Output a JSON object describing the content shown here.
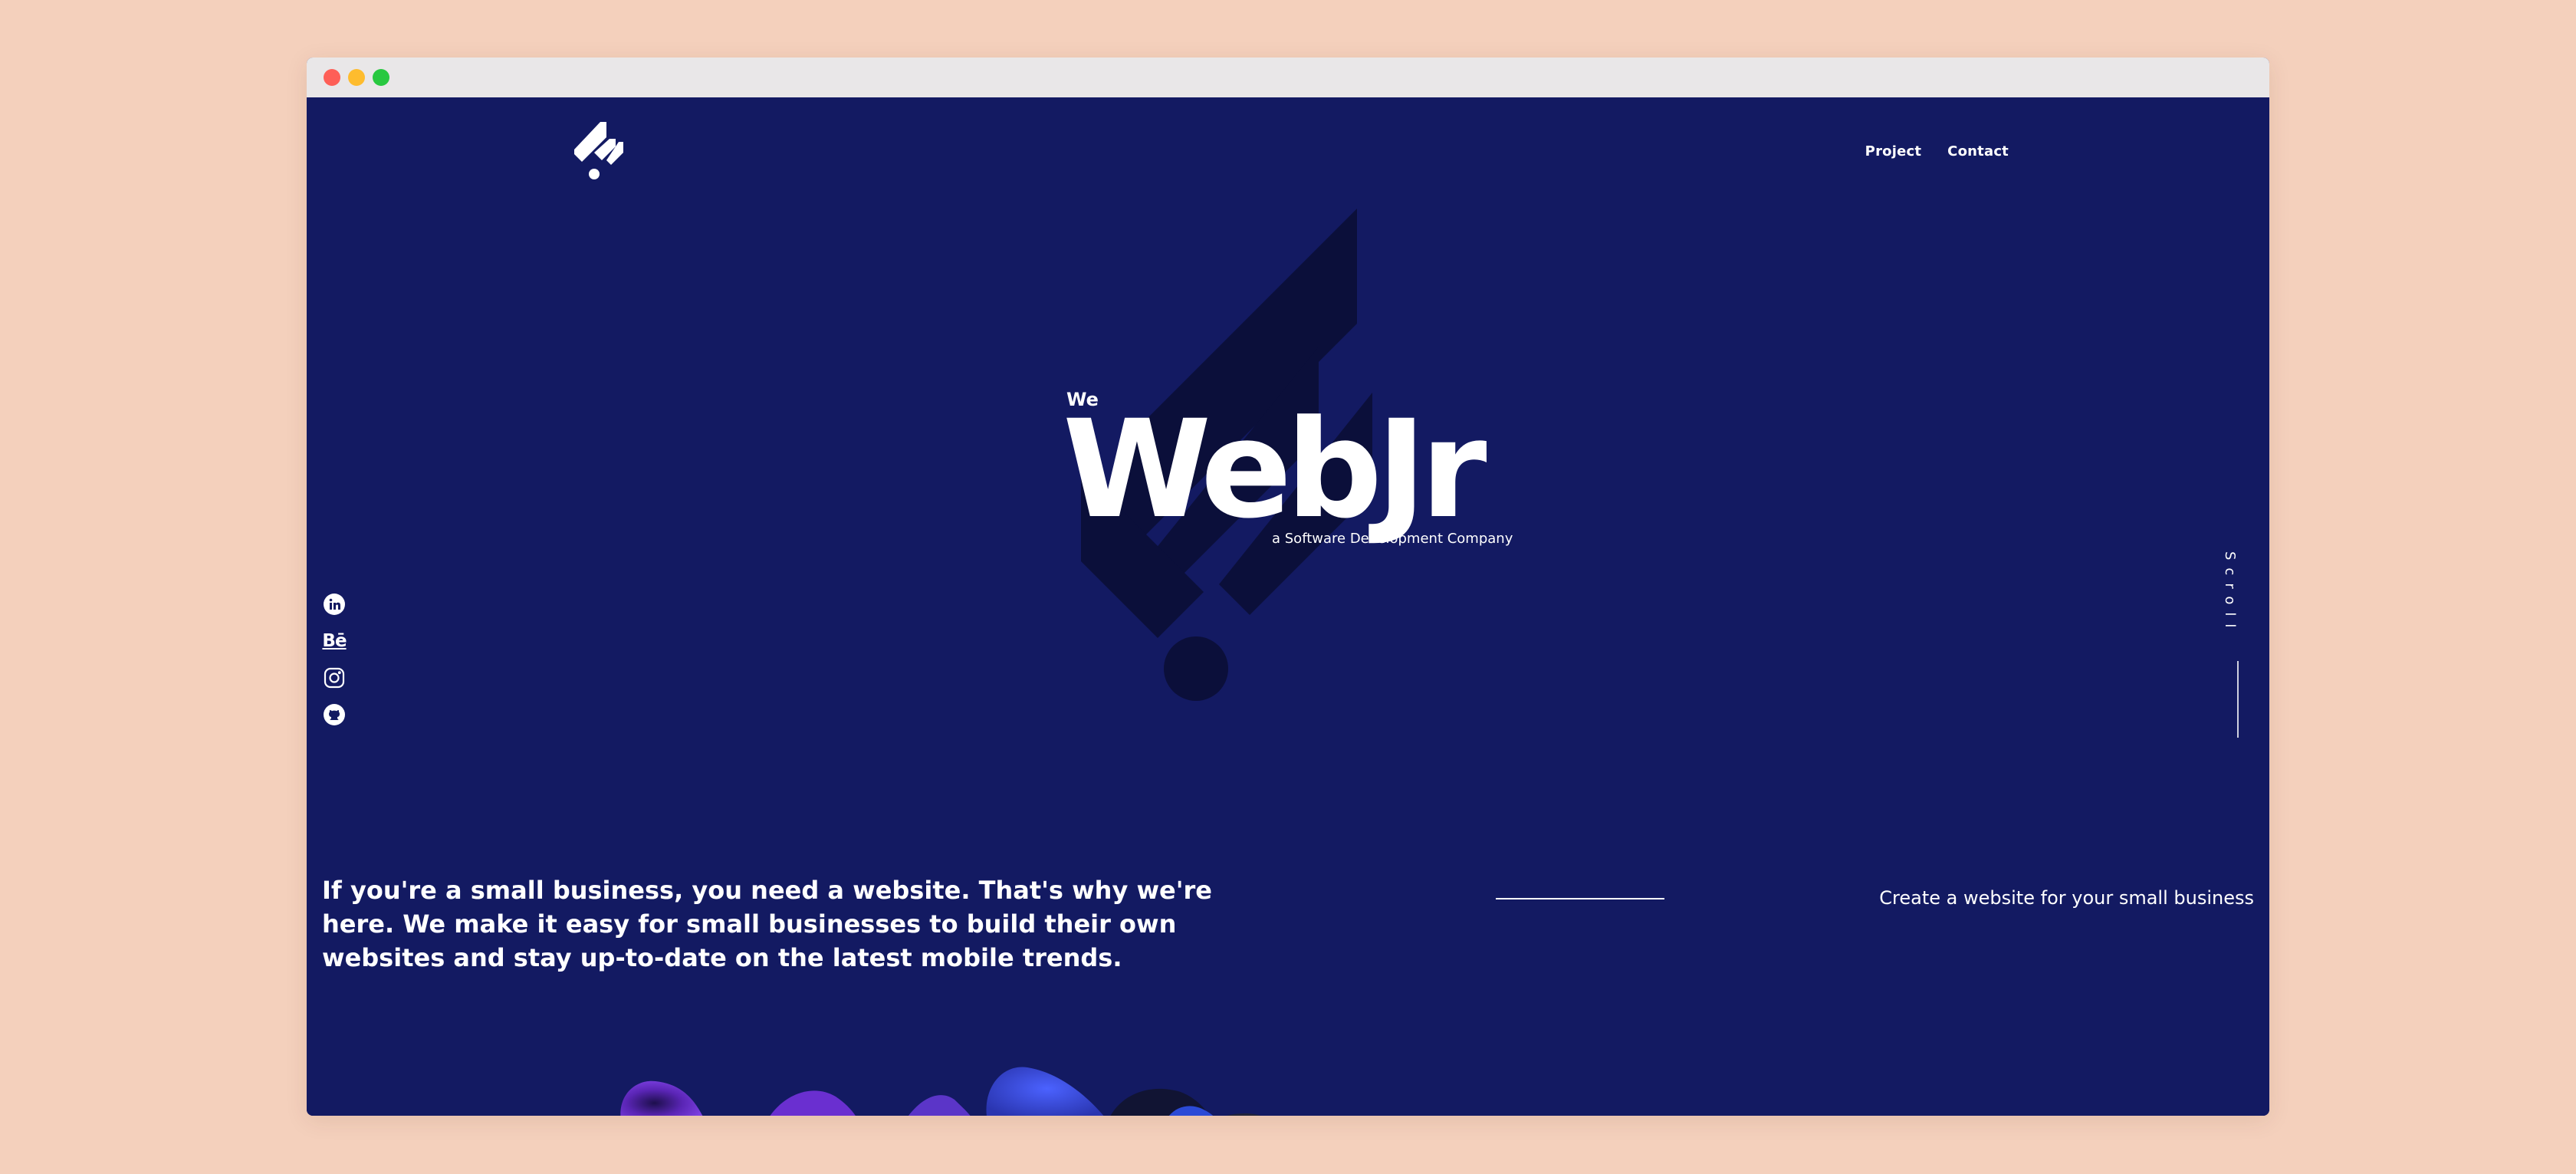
{
  "nav": {
    "items": [
      "Project",
      "Contact"
    ]
  },
  "hero": {
    "eyebrow": "We",
    "title": "WebJr",
    "subtitle": "a Software Development Company"
  },
  "social": {
    "icons": [
      "linkedin-icon",
      "behance-icon",
      "instagram-icon",
      "github-icon"
    ],
    "behance_label": "Bē"
  },
  "scroll": {
    "label": "Scroll"
  },
  "intro": {
    "text": "If you're a small business, you need a website. That's why we're here. We make it easy for small businesses to build their own websites and stay up-to-date on the latest mobile trends."
  },
  "cta": {
    "text": "Create a website for your small business"
  },
  "colors": {
    "background": "#131a62",
    "watermark": "#0b0f3a",
    "text": "#ffffff",
    "desktop": "#f4d0bc"
  }
}
